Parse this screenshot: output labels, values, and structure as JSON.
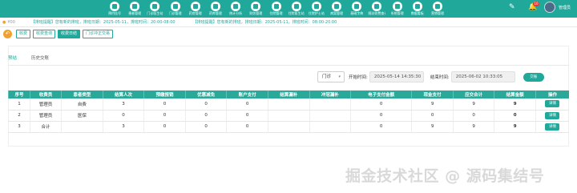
{
  "nav": {
    "items": [
      {
        "label": "预约挂号",
        "icon": "calendar-icon"
      },
      {
        "label": "患者管理",
        "icon": "patient-icon"
      },
      {
        "label": "门诊医生站",
        "icon": "doctor-icon"
      },
      {
        "label": "门诊管理",
        "icon": "clinic-icon"
      },
      {
        "label": "药房管理",
        "icon": "pharmacy-icon"
      },
      {
        "label": "药库管理",
        "icon": "warehouse-icon"
      },
      {
        "label": "统计分析",
        "icon": "chart-icon"
      },
      {
        "label": "财务管理",
        "icon": "finance-icon"
      },
      {
        "label": "住院管理",
        "icon": "hospital-icon"
      },
      {
        "label": "住院医生站",
        "icon": "ward-doctor-icon"
      },
      {
        "label": "住院护士站",
        "icon": "nurse-icon"
      },
      {
        "label": "病案管理",
        "icon": "record-icon"
      },
      {
        "label": "基础字典",
        "icon": "dictionary-icon"
      },
      {
        "label": "随访收费查询",
        "icon": "followup-icon"
      },
      {
        "label": "系统管理",
        "icon": "system-icon"
      },
      {
        "label": "数据看板",
        "icon": "dashboard-icon"
      },
      {
        "label": "营销管理",
        "icon": "marketing-icon"
      }
    ]
  },
  "header": {
    "badge_count": "10",
    "user_name": "管理员"
  },
  "notice": {
    "coin_label": "¥00",
    "messages": [
      "【排班提醒】您有新的排班，排班日期：2025-05-11，排班时间：20:00-08:00",
      "【排班提醒】您有新的排班，排班日期：2025-05-11，排班时间：08:00-20:00"
    ]
  },
  "toolbar": {
    "tabs": [
      "收费",
      "收费查询",
      "收费日结",
      "门诊冲正交易"
    ],
    "active_index": 2
  },
  "subtabs": {
    "items": [
      "预结",
      "历史交账"
    ],
    "active_index": 0
  },
  "filters": {
    "type_value": "门诊",
    "start_label": "开始时间:",
    "start_value": "2025-05-14 14:35:30",
    "end_label": "结束时间:",
    "end_value": "2025-06-02 10:33:05",
    "search_label": "交账"
  },
  "table": {
    "columns": [
      "序号",
      "收费员",
      "患者类型",
      "结算人次",
      "预缴报销",
      "优惠减免",
      "账户支付",
      "结算漏补",
      "冲冠漏补",
      "电子支付金额",
      "现金支付",
      "应交合计",
      "结算金额",
      "操作"
    ],
    "rows": [
      [
        "1",
        "管理员",
        "自费",
        "3",
        "0",
        "0",
        "0",
        "",
        "",
        "0",
        "9",
        "9",
        "9",
        "详情"
      ],
      [
        "2",
        "管理员",
        "医保",
        "0",
        "0",
        "0",
        "0",
        "",
        "",
        "0",
        "0",
        "0",
        "0",
        "详情"
      ],
      [
        "3",
        "合计",
        "",
        "3",
        "0",
        "0",
        "0",
        "",
        "",
        "0",
        "9",
        "9",
        "9",
        "详情"
      ]
    ]
  },
  "watermark": "掘金技术社区 @ 源码集结号",
  "colors": {
    "primary": "#20a89b",
    "accent": "#f0a030",
    "badge": "#e53935"
  }
}
